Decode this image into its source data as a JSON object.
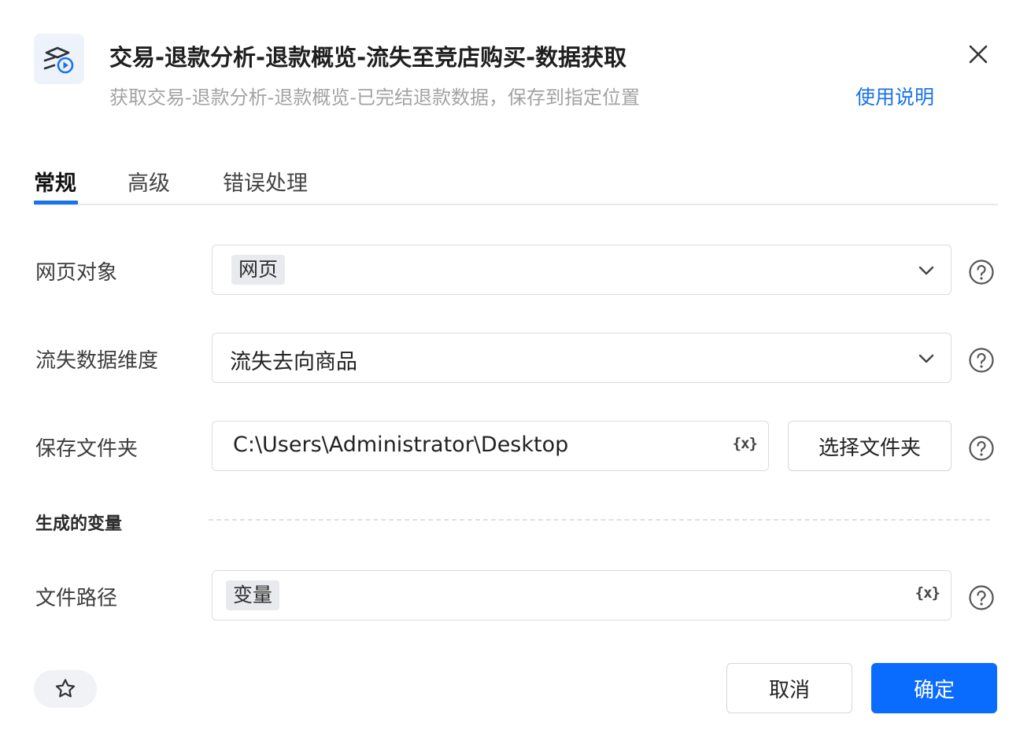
{
  "header": {
    "title": "交易-退款分析-退款概览-流失至竞店购买-数据获取",
    "subtitle": "获取交易-退款分析-退款概览-已完结退款数据，保存到指定位置",
    "help_link": "使用说明",
    "icon": "app-flow-icon",
    "close_icon": "close-icon"
  },
  "tabs": [
    {
      "label": "常规",
      "active": true
    },
    {
      "label": "高级",
      "active": false
    },
    {
      "label": "错误处理",
      "active": false
    }
  ],
  "form": {
    "web_object": {
      "label": "网页对象",
      "value": "网页"
    },
    "loss_dimension": {
      "label": "流失数据维度",
      "value": "流失去向商品"
    },
    "save_folder": {
      "label": "保存文件夹",
      "value": "C:\\Users\\Administrator\\Desktop",
      "variable_icon": "{x}",
      "choose_button": "选择文件夹"
    },
    "generated_section": "生成的变量",
    "file_path": {
      "label": "文件路径",
      "value": "变量",
      "variable_icon": "{x}"
    }
  },
  "footer": {
    "cancel": "取消",
    "confirm": "确定",
    "favorite_icon": "star-icon"
  },
  "colors": {
    "accent": "#1a73e8",
    "primary_button": "#0a6cff",
    "subtitle": "#a3a3a3"
  }
}
